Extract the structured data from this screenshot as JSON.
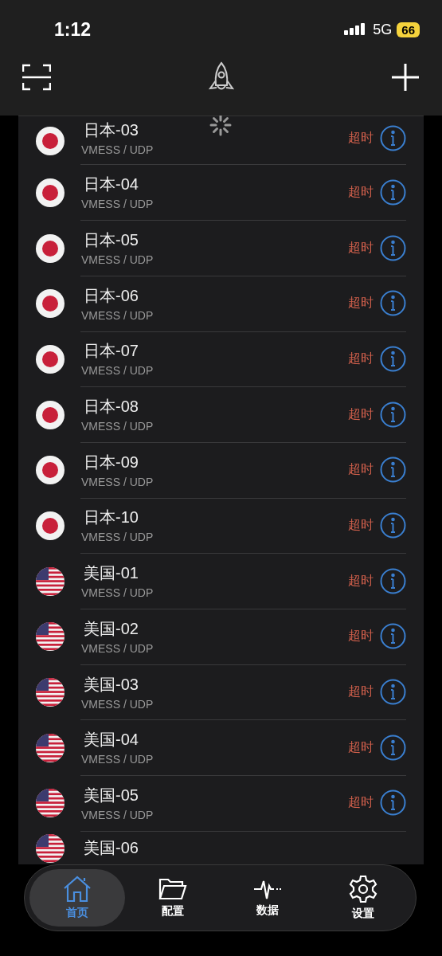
{
  "status_bar": {
    "time": "1:12",
    "network": "5G",
    "battery": "66"
  },
  "nodes": [
    {
      "kind": "jp",
      "name": "日本-03",
      "protocol": "VMESS / UDP",
      "status": "超时"
    },
    {
      "kind": "jp",
      "name": "日本-04",
      "protocol": "VMESS / UDP",
      "status": "超时"
    },
    {
      "kind": "jp",
      "name": "日本-05",
      "protocol": "VMESS / UDP",
      "status": "超时"
    },
    {
      "kind": "jp",
      "name": "日本-06",
      "protocol": "VMESS / UDP",
      "status": "超时"
    },
    {
      "kind": "jp",
      "name": "日本-07",
      "protocol": "VMESS / UDP",
      "status": "超时"
    },
    {
      "kind": "jp",
      "name": "日本-08",
      "protocol": "VMESS / UDP",
      "status": "超时"
    },
    {
      "kind": "jp",
      "name": "日本-09",
      "protocol": "VMESS / UDP",
      "status": "超时"
    },
    {
      "kind": "jp",
      "name": "日本-10",
      "protocol": "VMESS / UDP",
      "status": "超时"
    },
    {
      "kind": "us",
      "name": "美国-01",
      "protocol": "VMESS / UDP",
      "status": "超时"
    },
    {
      "kind": "us",
      "name": "美国-02",
      "protocol": "VMESS / UDP",
      "status": "超时"
    },
    {
      "kind": "us",
      "name": "美国-03",
      "protocol": "VMESS / UDP",
      "status": "超时"
    },
    {
      "kind": "us",
      "name": "美国-04",
      "protocol": "VMESS / UDP",
      "status": "超时"
    },
    {
      "kind": "us",
      "name": "美国-05",
      "protocol": "VMESS / UDP",
      "status": "超时"
    },
    {
      "kind": "us",
      "name": "美国-06"
    }
  ],
  "tabs": [
    {
      "kind": "home",
      "label": "首页",
      "selected": true
    },
    {
      "kind": "folder",
      "label": "配置",
      "selected": false
    },
    {
      "kind": "pulse",
      "label": "数据",
      "selected": false
    },
    {
      "kind": "gear",
      "label": "设置",
      "selected": false
    }
  ]
}
